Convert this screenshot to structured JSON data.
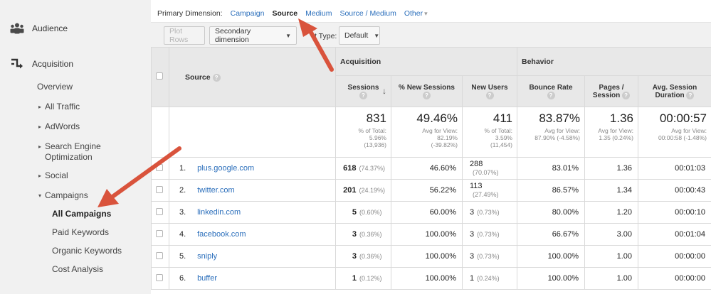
{
  "sidebar": {
    "audience": "Audience",
    "acquisition": "Acquisition",
    "overview": "Overview",
    "all_traffic": "All Traffic",
    "adwords": "AdWords",
    "seo_line1": "Search Engine",
    "seo_line2": "Optimization",
    "social": "Social",
    "campaigns": "Campaigns",
    "all_campaigns": "All Campaigns",
    "paid_keywords": "Paid Keywords",
    "organic_keywords": "Organic Keywords",
    "cost_analysis": "Cost Analysis"
  },
  "primary_dimension": {
    "label": "Primary Dimension:",
    "options": [
      "Campaign",
      "Source",
      "Medium",
      "Source / Medium",
      "Other"
    ],
    "selected": "Source"
  },
  "toolbar": {
    "plot_rows": "Plot Rows",
    "secondary_dimension": "Secondary dimension",
    "type_label": "t Type:",
    "type_value": "Default"
  },
  "table": {
    "group_acquisition": "Acquisition",
    "group_behavior": "Behavior",
    "col_source": "Source",
    "col_sessions": "Sessions",
    "col_new_sessions": "% New Sessions",
    "col_new_users": "New Users",
    "col_bounce_rate": "Bounce Rate",
    "col_pages_session_1": "Pages /",
    "col_pages_session_2": "Session",
    "col_avg_duration_1": "Avg. Session",
    "col_avg_duration_2": "Duration",
    "totals": {
      "sessions": "831",
      "sessions_sub1": "% of Total:",
      "sessions_sub2": "5.96%",
      "sessions_sub3": "(13,936)",
      "new_sessions": "49.46%",
      "new_sessions_sub1": "Avg for View:",
      "new_sessions_sub2": "82.19%",
      "new_sessions_sub3": "(-39.82%)",
      "new_users": "411",
      "new_users_sub1": "% of Total:",
      "new_users_sub2": "3.59%",
      "new_users_sub3": "(11,454)",
      "bounce_rate": "83.87%",
      "bounce_rate_sub1": "Avg for View:",
      "bounce_rate_sub2": "87.90% (-4.58%)",
      "pages": "1.36",
      "pages_sub1": "Avg for View:",
      "pages_sub2": "1.35 (0.24%)",
      "duration": "00:00:57",
      "duration_sub1": "Avg for View:",
      "duration_sub2": "00:00:58 (-1.48%)"
    },
    "rows": [
      {
        "idx": "1.",
        "source": "plus.google.com",
        "sessions": "618",
        "sessions_pct": "(74.37%)",
        "new_sessions": "46.60%",
        "new_users": "288",
        "new_users_pct": "(70.07%)",
        "bounce": "83.01%",
        "pages": "1.36",
        "duration": "00:01:03"
      },
      {
        "idx": "2.",
        "source": "twitter.com",
        "sessions": "201",
        "sessions_pct": "(24.19%)",
        "new_sessions": "56.22%",
        "new_users": "113",
        "new_users_pct": "(27.49%)",
        "bounce": "86.57%",
        "pages": "1.34",
        "duration": "00:00:43"
      },
      {
        "idx": "3.",
        "source": "linkedin.com",
        "sessions": "5",
        "sessions_pct": "(0.60%)",
        "new_sessions": "60.00%",
        "new_users": "3",
        "new_users_pct": "(0.73%)",
        "bounce": "80.00%",
        "pages": "1.20",
        "duration": "00:00:10"
      },
      {
        "idx": "4.",
        "source": "facebook.com",
        "sessions": "3",
        "sessions_pct": "(0.36%)",
        "new_sessions": "100.00%",
        "new_users": "3",
        "new_users_pct": "(0.73%)",
        "bounce": "66.67%",
        "pages": "3.00",
        "duration": "00:01:04"
      },
      {
        "idx": "5.",
        "source": "sniply",
        "sessions": "3",
        "sessions_pct": "(0.36%)",
        "new_sessions": "100.00%",
        "new_users": "3",
        "new_users_pct": "(0.73%)",
        "bounce": "100.00%",
        "pages": "1.00",
        "duration": "00:00:00"
      },
      {
        "idx": "6.",
        "source": "buffer",
        "sessions": "1",
        "sessions_pct": "(0.12%)",
        "new_sessions": "100.00%",
        "new_users": "1",
        "new_users_pct": "(0.24%)",
        "bounce": "100.00%",
        "pages": "1.00",
        "duration": "00:00:00"
      }
    ]
  },
  "colors": {
    "link": "#2a6ebb",
    "annotation_arrow": "#d9533c",
    "sidebar_bg": "#f1f1f1"
  },
  "icons": {
    "audience": "people-icon",
    "acquisition": "acquisition-arrows-icon"
  }
}
